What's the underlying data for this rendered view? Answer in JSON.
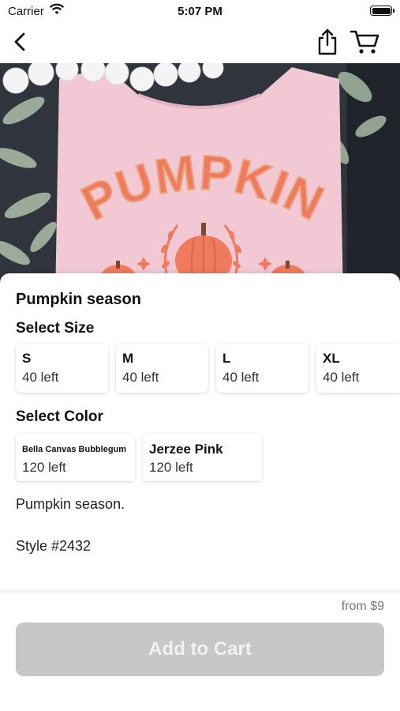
{
  "status_bar": {
    "carrier": "Carrier",
    "time": "5:07 PM"
  },
  "nav": {
    "back_icon": "chevron-left-icon",
    "share_icon": "share-icon",
    "cart_icon": "cart-icon"
  },
  "product": {
    "image_text": "PUMPKIN",
    "title": "Pumpkin season",
    "select_size_label": "Select Size",
    "sizes": [
      {
        "name": "S",
        "stock": "40 left"
      },
      {
        "name": "M",
        "stock": "40 left"
      },
      {
        "name": "L",
        "stock": "40 left"
      },
      {
        "name": "XL",
        "stock": "40 left"
      }
    ],
    "select_color_label": "Select Color",
    "colors": [
      {
        "name": "Bella Canvas Bubblegum",
        "stock": "120 left"
      },
      {
        "name": "Jerzee Pink",
        "stock": "120 left"
      }
    ],
    "description": "Pumpkin season.",
    "style": "Style #2432"
  },
  "footer": {
    "price": "from $9",
    "add_to_cart_label": "Add to Cart"
  },
  "colors": {
    "shirt": "#f1c8d4",
    "print": "#ef7a5d",
    "button_disabled": "#c7c7c7"
  }
}
